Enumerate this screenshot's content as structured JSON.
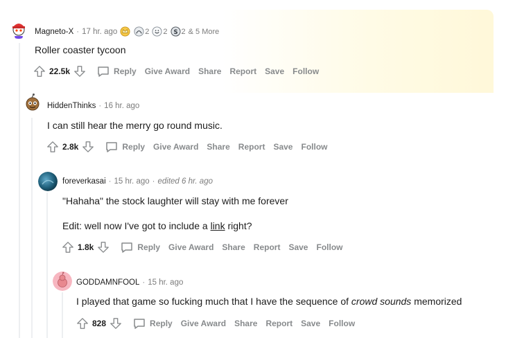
{
  "comments": [
    {
      "author": "Magneto-X",
      "time": "17 hr. ago",
      "awards": [
        {
          "icon": "crown-award-icon",
          "count": ""
        },
        {
          "icon": "helpful-award-icon",
          "count": "2"
        },
        {
          "icon": "wholesome-award-icon",
          "count": "2"
        },
        {
          "icon": "silver-award-icon",
          "count": "2"
        }
      ],
      "more_awards": "& 5 More",
      "text": "Roller coaster tycoon",
      "score": "22.5k",
      "avatar": "snoo-red-cap-avatar"
    },
    {
      "author": "HiddenThinks",
      "time": "16 hr. ago",
      "text": "I can still hear the merry go round music.",
      "score": "2.8k",
      "avatar": "snoo-brown-avatar"
    },
    {
      "author": "foreverkasai",
      "time": "15 hr. ago",
      "edited": "edited 6 hr. ago",
      "text": "\"Hahaha\" the stock laughter will stay with me forever",
      "text2_prefix": "Edit: well now I've got to include a ",
      "text2_link": "link",
      "text2_suffix": " right?",
      "score": "1.8k",
      "avatar": "blue-photo-avatar"
    },
    {
      "author": "GODDAMNFOOL",
      "time": "15 hr. ago",
      "text_prefix": "I played that game so fucking much that I have the sequence of ",
      "text_italic": "crowd sounds",
      "text_suffix": " memorized",
      "score": "828",
      "avatar": "snoo-pink-avatar"
    }
  ],
  "actions": {
    "reply": "Reply",
    "give_award": "Give Award",
    "share": "Share",
    "report": "Report",
    "save": "Save",
    "follow": "Follow"
  },
  "colors": {
    "meta_gray": "#7c7c7c",
    "action_gray": "#878a8c",
    "thread_line": "#edeff1",
    "award_glow": "#fff8d9"
  }
}
